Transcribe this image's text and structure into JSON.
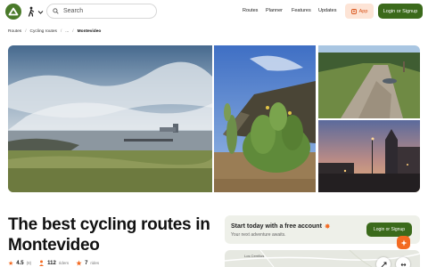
{
  "header": {
    "search_placeholder": "Search",
    "nav": [
      {
        "label": "Routes"
      },
      {
        "label": "Planner"
      },
      {
        "label": "Features"
      },
      {
        "label": "Updates"
      }
    ],
    "app_label": "App",
    "login_label": "Login or Signup"
  },
  "breadcrumb": [
    "Routes",
    "Cycling routes",
    "...",
    "Montevideo"
  ],
  "title": "The best cycling routes in Montevideo",
  "stats": {
    "rating": "4.5",
    "rating_count": "(8)",
    "riders": "112",
    "riders_label": "riders",
    "rides": "7",
    "rides_label": "rides"
  },
  "promo": {
    "title": "Start today with a free account",
    "subtitle": "Your next adventure awaits.",
    "button": "Login or Signup"
  },
  "map": {
    "label": "Los Cerrillos"
  },
  "colors": {
    "brand_green": "#3b6a1b",
    "accent_orange": "#f36a21"
  }
}
